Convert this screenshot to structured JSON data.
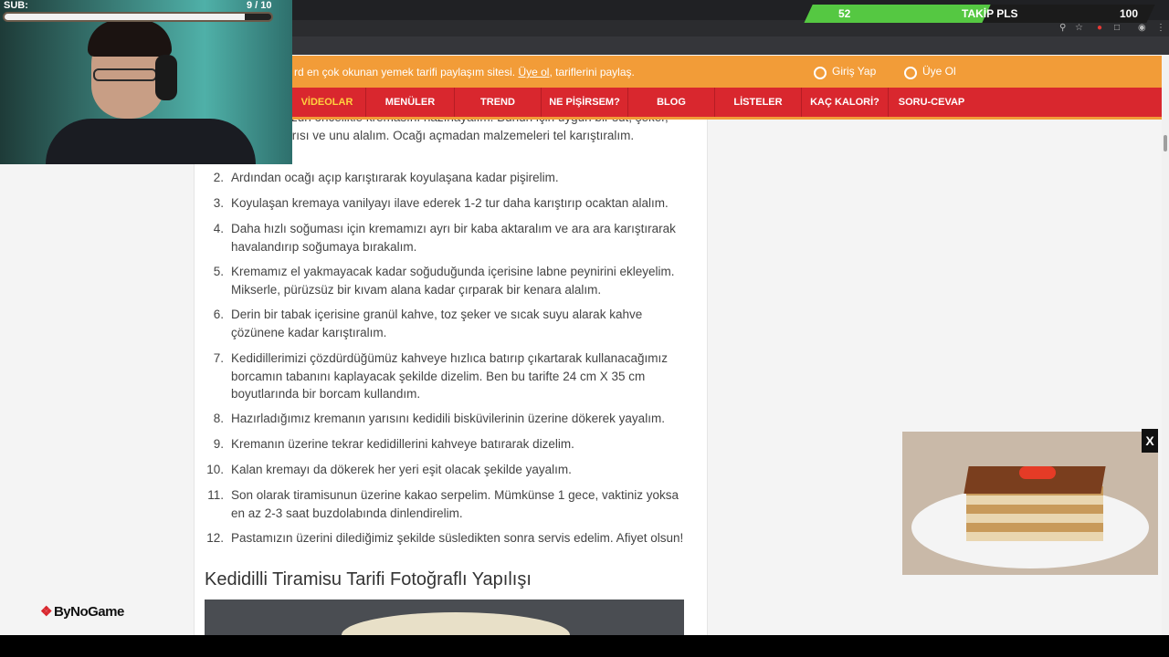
{
  "stream": {
    "sub_label": "SUB:",
    "sub_count": "9 / 10",
    "sub_progress": 0.9,
    "follow_count": "52",
    "follow_label": "TAKİP PLS",
    "follow_goal": "100",
    "follow_progress": 0.52,
    "brand": "ByNoGame"
  },
  "header": {
    "tagline_pre": "rd en çok okunan yemek tarifi paylaşım sitesi.",
    "tagline_link": "Üye ol",
    "tagline_post": ", tariflerini paylaş.",
    "login": "Giriş Yap",
    "register": "Üye Ol"
  },
  "menu": [
    "VİDEOLAR",
    "MENÜLER",
    "TREND",
    "NE PİŞİRSEM?",
    "BLOG",
    "LİSTELER",
    "KAÇ KALORİ?",
    "SORU-CEVAP"
  ],
  "steps": [
    {
      "num": "",
      "text": "...amisumuzun öncelikle kremasını hazırlayalım. Bunun için uygun bir süt, şeker, yumurta sarısı ve unu alalım. Ocağı açmadan malzemeleri tel karıştıralım."
    },
    {
      "num": "2.",
      "text": "Ardından ocağı açıp karıştırarak koyulaşana kadar pişirelim."
    },
    {
      "num": "3.",
      "text": "Koyulaşan kremaya vanilyayı ilave ederek 1-2 tur daha karıştırıp ocaktan alalım."
    },
    {
      "num": "4.",
      "text": "Daha hızlı soğuması için kremamızı ayrı bir kaba aktaralım ve ara ara karıştırarak havalandırıp soğumaya bırakalım."
    },
    {
      "num": "5.",
      "text": "Kremamız el yakmayacak kadar soğuduğunda içerisine labne peynirini ekleyelim. Mikserle, pürüzsüz bir kıvam alana kadar çırparak bir kenara alalım."
    },
    {
      "num": "6.",
      "text": "Derin bir tabak içerisine granül kahve, toz şeker ve sıcak suyu alarak kahve çözünene kadar karıştıralım."
    },
    {
      "num": "7.",
      "text": "Kedidillerimizi çözdürdüğümüz kahveye hızlıca batırıp çıkartarak kullanacağımız borcamın tabanını kaplayacak şekilde dizelim. Ben bu tarifte 24 cm X 35 cm boyutlarında bir borcam kullandım."
    },
    {
      "num": "8.",
      "text": "Hazırladığımız kremanın yarısını kedidili bisküvilerinin üzerine dökerek yayalım."
    },
    {
      "num": "9.",
      "text": "Kremanın üzerine tekrar kedidillerini kahveye batırarak dizelim."
    },
    {
      "num": "10.",
      "text": "Kalan kremayı da dökerek her yeri eşit olacak şekilde yayalım."
    },
    {
      "num": "11.",
      "text": "Son olarak tiramisunun üzerine kakao serpelim. Mümkünse 1 gece, vaktiniz yoksa en az 2-3 saat buzdolabında dinlendirelim."
    },
    {
      "num": "12.",
      "text": "Pastamızın üzerini dilediğimiz şekilde süsledikten sonra servis edelim. Afiyet olsun!"
    }
  ],
  "section_heading": "Kedidilli Tiramisu Tarifi Fotoğraflı Yapılışı",
  "popup": {
    "close": "X"
  },
  "icons": [
    "user-icon",
    "user-plus-icon",
    "zoom-icon",
    "star-icon",
    "extension-icon",
    "tab-icon",
    "profile-icon",
    "menu-dots-icon",
    "close-icon"
  ]
}
